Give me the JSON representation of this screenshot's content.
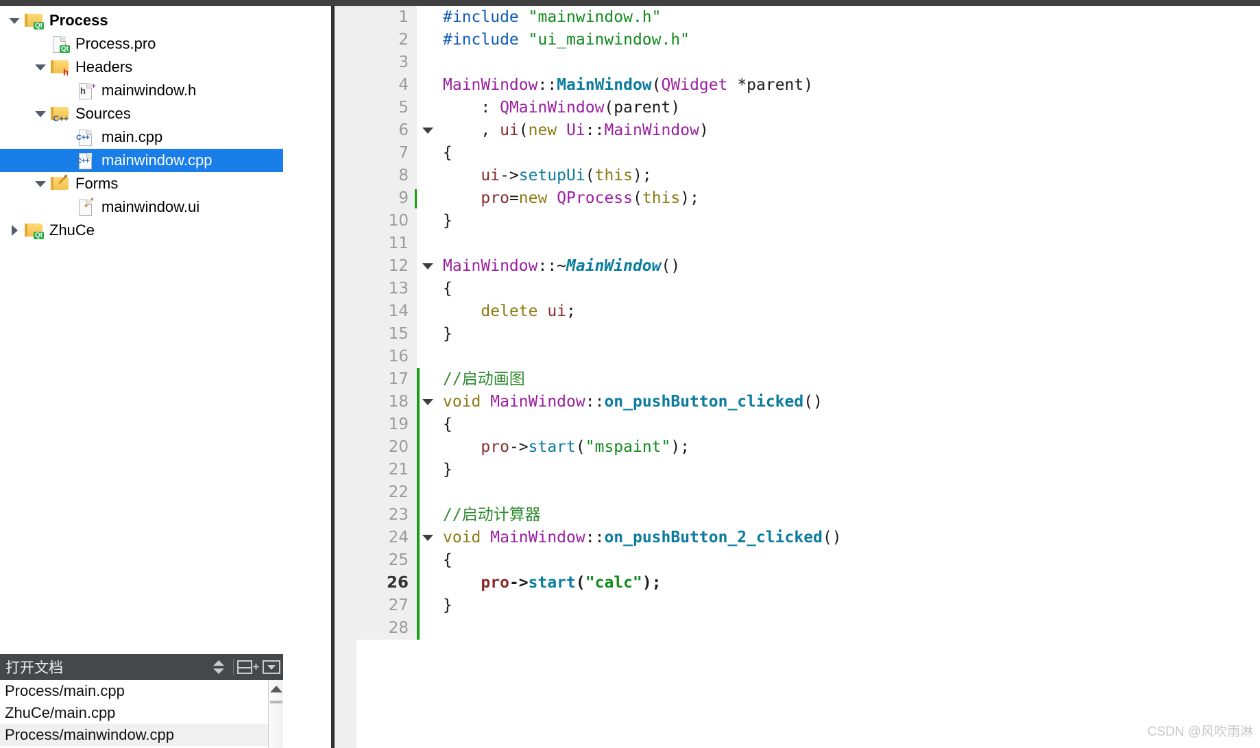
{
  "sidebar": {
    "tree": [
      {
        "label": "Process",
        "indent": 0,
        "twisty": "open",
        "icon": "qt-folder-icon",
        "bold": true,
        "selected": false
      },
      {
        "label": "Process.pro",
        "indent": 1,
        "twisty": "none",
        "icon": "qt-file-icon",
        "bold": false,
        "selected": false
      },
      {
        "label": "Headers",
        "indent": 1,
        "twisty": "open",
        "icon": "h-folder-icon",
        "bold": false,
        "selected": false
      },
      {
        "label": "mainwindow.h",
        "indent": 2,
        "twisty": "none",
        "icon": "h-file-icon",
        "bold": false,
        "selected": false
      },
      {
        "label": "Sources",
        "indent": 1,
        "twisty": "open",
        "icon": "cpp-folder-icon",
        "bold": false,
        "selected": false
      },
      {
        "label": "main.cpp",
        "indent": 2,
        "twisty": "none",
        "icon": "cpp-file-icon",
        "bold": false,
        "selected": false
      },
      {
        "label": "mainwindow.cpp",
        "indent": 2,
        "twisty": "none",
        "icon": "cpp-file-icon",
        "bold": false,
        "selected": true
      },
      {
        "label": "Forms",
        "indent": 1,
        "twisty": "open",
        "icon": "ui-folder-icon",
        "bold": false,
        "selected": false
      },
      {
        "label": "mainwindow.ui",
        "indent": 2,
        "twisty": "none",
        "icon": "ui-file-icon",
        "bold": false,
        "selected": false
      },
      {
        "label": "ZhuCe",
        "indent": 0,
        "twisty": "closed",
        "icon": "qt-folder-icon",
        "bold": false,
        "selected": false
      }
    ]
  },
  "documents_panel": {
    "title": "打开文档",
    "buttons": [
      {
        "name": "sort-updown-button",
        "icon": "up-down-arrows-icon"
      },
      {
        "name": "split-add-button",
        "icon": "split-plus-icon"
      },
      {
        "name": "close-dropdown-button",
        "icon": "dropdown-box-icon"
      }
    ],
    "items": [
      {
        "label": "Process/main.cpp",
        "alt": false
      },
      {
        "label": "ZhuCe/main.cpp",
        "alt": false
      },
      {
        "label": "Process/mainwindow.cpp",
        "alt": true
      }
    ]
  },
  "editor": {
    "filename": "mainwindow.cpp",
    "cursor_line": 9,
    "current_line": 26,
    "lines": [
      {
        "n": 1,
        "fold": false,
        "change": false,
        "cursor": false,
        "bold": false,
        "tokens": [
          {
            "t": "#include ",
            "c": "t-pre"
          },
          {
            "t": "\"mainwindow.h\"",
            "c": "t-str"
          }
        ]
      },
      {
        "n": 2,
        "fold": false,
        "change": false,
        "cursor": false,
        "bold": false,
        "tokens": [
          {
            "t": "#include ",
            "c": "t-pre"
          },
          {
            "t": "\"ui_mainwindow.h\"",
            "c": "t-str"
          }
        ]
      },
      {
        "n": 3,
        "fold": false,
        "change": false,
        "cursor": false,
        "bold": false,
        "tokens": []
      },
      {
        "n": 4,
        "fold": false,
        "change": false,
        "cursor": false,
        "bold": false,
        "tokens": [
          {
            "t": "MainWindow",
            "c": "t-cls"
          },
          {
            "t": "::",
            "c": "t-punct"
          },
          {
            "t": "MainWindow",
            "c": "t-fn"
          },
          {
            "t": "(",
            "c": "t-punct"
          },
          {
            "t": "QWidget",
            "c": "t-cls"
          },
          {
            "t": " *",
            "c": "t-punct"
          },
          {
            "t": "parent",
            "c": "t-plain"
          },
          {
            "t": ")",
            "c": "t-punct"
          }
        ]
      },
      {
        "n": 5,
        "fold": false,
        "change": false,
        "cursor": false,
        "bold": false,
        "tokens": [
          {
            "t": "    : ",
            "c": "t-punct"
          },
          {
            "t": "QMainWindow",
            "c": "t-cls"
          },
          {
            "t": "(",
            "c": "t-punct"
          },
          {
            "t": "parent",
            "c": "t-plain"
          },
          {
            "t": ")",
            "c": "t-punct"
          }
        ]
      },
      {
        "n": 6,
        "fold": true,
        "change": false,
        "cursor": false,
        "bold": false,
        "tokens": [
          {
            "t": "    , ",
            "c": "t-punct"
          },
          {
            "t": "ui",
            "c": "t-var"
          },
          {
            "t": "(",
            "c": "t-punct"
          },
          {
            "t": "new",
            "c": "t-kw"
          },
          {
            "t": " ",
            "c": "t-plain"
          },
          {
            "t": "Ui",
            "c": "t-cls"
          },
          {
            "t": "::",
            "c": "t-punct"
          },
          {
            "t": "MainWindow",
            "c": "t-cls"
          },
          {
            "t": ")",
            "c": "t-punct"
          }
        ]
      },
      {
        "n": 7,
        "fold": false,
        "change": false,
        "cursor": false,
        "bold": false,
        "tokens": [
          {
            "t": "{",
            "c": "t-punct"
          }
        ]
      },
      {
        "n": 8,
        "fold": false,
        "change": false,
        "cursor": false,
        "bold": false,
        "tokens": [
          {
            "t": "    ",
            "c": "t-plain"
          },
          {
            "t": "ui",
            "c": "t-var"
          },
          {
            "t": "->",
            "c": "t-punct"
          },
          {
            "t": "setupUi",
            "c": "t-meth"
          },
          {
            "t": "(",
            "c": "t-punct"
          },
          {
            "t": "this",
            "c": "t-kw"
          },
          {
            "t": ");",
            "c": "t-punct"
          }
        ]
      },
      {
        "n": 9,
        "fold": false,
        "change": false,
        "cursor": true,
        "bold": false,
        "tokens": [
          {
            "t": "    ",
            "c": "t-plain"
          },
          {
            "t": "pro",
            "c": "t-var"
          },
          {
            "t": "=",
            "c": "t-punct"
          },
          {
            "t": "new",
            "c": "t-kw"
          },
          {
            "t": " ",
            "c": "t-plain"
          },
          {
            "t": "QProcess",
            "c": "t-cls"
          },
          {
            "t": "(",
            "c": "t-punct"
          },
          {
            "t": "this",
            "c": "t-kw"
          },
          {
            "t": ");",
            "c": "t-punct"
          }
        ]
      },
      {
        "n": 10,
        "fold": false,
        "change": false,
        "cursor": false,
        "bold": false,
        "tokens": [
          {
            "t": "}",
            "c": "t-punct"
          }
        ]
      },
      {
        "n": 11,
        "fold": false,
        "change": false,
        "cursor": false,
        "bold": false,
        "tokens": []
      },
      {
        "n": 12,
        "fold": true,
        "change": false,
        "cursor": false,
        "bold": false,
        "tokens": [
          {
            "t": "MainWindow",
            "c": "t-cls"
          },
          {
            "t": "::~",
            "c": "t-punct"
          },
          {
            "t": "MainWindow",
            "c": "t-fnit"
          },
          {
            "t": "()",
            "c": "t-punct"
          }
        ]
      },
      {
        "n": 13,
        "fold": false,
        "change": false,
        "cursor": false,
        "bold": false,
        "tokens": [
          {
            "t": "{",
            "c": "t-punct"
          }
        ]
      },
      {
        "n": 14,
        "fold": false,
        "change": false,
        "cursor": false,
        "bold": false,
        "tokens": [
          {
            "t": "    ",
            "c": "t-plain"
          },
          {
            "t": "delete",
            "c": "t-kw"
          },
          {
            "t": " ",
            "c": "t-plain"
          },
          {
            "t": "ui",
            "c": "t-var"
          },
          {
            "t": ";",
            "c": "t-punct"
          }
        ]
      },
      {
        "n": 15,
        "fold": false,
        "change": false,
        "cursor": false,
        "bold": false,
        "tokens": [
          {
            "t": "}",
            "c": "t-punct"
          }
        ]
      },
      {
        "n": 16,
        "fold": false,
        "change": false,
        "cursor": false,
        "bold": false,
        "tokens": []
      },
      {
        "n": 17,
        "fold": false,
        "change": true,
        "cursor": false,
        "bold": false,
        "tokens": [
          {
            "t": "//启动画图",
            "c": "t-cmt"
          }
        ]
      },
      {
        "n": 18,
        "fold": true,
        "change": true,
        "cursor": false,
        "bold": false,
        "tokens": [
          {
            "t": "void",
            "c": "t-kw"
          },
          {
            "t": " ",
            "c": "t-plain"
          },
          {
            "t": "MainWindow",
            "c": "t-cls"
          },
          {
            "t": "::",
            "c": "t-punct"
          },
          {
            "t": "on_pushButton_clicked",
            "c": "t-fn"
          },
          {
            "t": "()",
            "c": "t-punct"
          }
        ]
      },
      {
        "n": 19,
        "fold": false,
        "change": true,
        "cursor": false,
        "bold": false,
        "tokens": [
          {
            "t": "{",
            "c": "t-punct"
          }
        ]
      },
      {
        "n": 20,
        "fold": false,
        "change": true,
        "cursor": false,
        "bold": false,
        "tokens": [
          {
            "t": "    ",
            "c": "t-plain"
          },
          {
            "t": "pro",
            "c": "t-var"
          },
          {
            "t": "->",
            "c": "t-punct"
          },
          {
            "t": "start",
            "c": "t-meth"
          },
          {
            "t": "(",
            "c": "t-punct"
          },
          {
            "t": "\"mspaint\"",
            "c": "t-str"
          },
          {
            "t": ");",
            "c": "t-punct"
          }
        ]
      },
      {
        "n": 21,
        "fold": false,
        "change": true,
        "cursor": false,
        "bold": false,
        "tokens": [
          {
            "t": "}",
            "c": "t-punct"
          }
        ]
      },
      {
        "n": 22,
        "fold": false,
        "change": true,
        "cursor": false,
        "bold": false,
        "tokens": []
      },
      {
        "n": 23,
        "fold": false,
        "change": true,
        "cursor": false,
        "bold": false,
        "tokens": [
          {
            "t": "//启动计算器",
            "c": "t-cmt"
          }
        ]
      },
      {
        "n": 24,
        "fold": true,
        "change": true,
        "cursor": false,
        "bold": false,
        "tokens": [
          {
            "t": "void",
            "c": "t-kw"
          },
          {
            "t": " ",
            "c": "t-plain"
          },
          {
            "t": "MainWindow",
            "c": "t-cls"
          },
          {
            "t": "::",
            "c": "t-punct"
          },
          {
            "t": "on_pushButton_2_clicked",
            "c": "t-fn"
          },
          {
            "t": "()",
            "c": "t-punct"
          }
        ]
      },
      {
        "n": 25,
        "fold": false,
        "change": true,
        "cursor": false,
        "bold": false,
        "tokens": [
          {
            "t": "{",
            "c": "t-punct"
          }
        ]
      },
      {
        "n": 26,
        "fold": false,
        "change": true,
        "cursor": false,
        "bold": true,
        "tokens": [
          {
            "t": "    ",
            "c": "t-plain"
          },
          {
            "t": "pro",
            "c": "t-var"
          },
          {
            "t": "->",
            "c": "t-punct"
          },
          {
            "t": "start",
            "c": "t-meth"
          },
          {
            "t": "(",
            "c": "t-punct"
          },
          {
            "t": "\"calc\"",
            "c": "t-str"
          },
          {
            "t": ");",
            "c": "t-punct"
          }
        ]
      },
      {
        "n": 27,
        "fold": false,
        "change": true,
        "cursor": false,
        "bold": false,
        "tokens": [
          {
            "t": "}",
            "c": "t-punct"
          }
        ]
      },
      {
        "n": 28,
        "fold": false,
        "change": true,
        "cursor": false,
        "bold": false,
        "tokens": []
      }
    ]
  },
  "watermark": {
    "text": "CSDN @风吹雨淋"
  },
  "colors": {
    "selection": "#1a7ee8",
    "panel_header": "#44484b",
    "change_marker": "#12a112",
    "gutter": "#efefef",
    "splitter": "#2e2e2e"
  }
}
